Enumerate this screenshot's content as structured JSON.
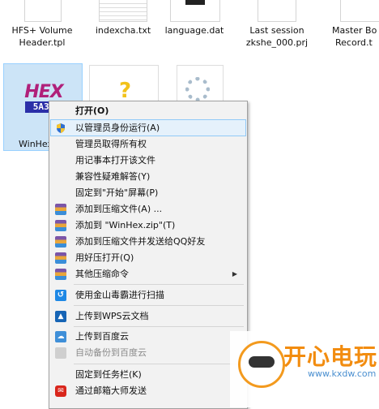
{
  "files": [
    {
      "label_line1": "HFS+ Volume",
      "label_line2": "Header.tpl"
    },
    {
      "label_line1": "indexcha.txt",
      "label_line2": ""
    },
    {
      "label_line1": "language.dat",
      "label_line2": ""
    },
    {
      "label_line1": "Last session",
      "label_line2": "zkshe_000.prj"
    },
    {
      "label_line1": "Master Bo",
      "label_line2": "Record.t"
    }
  ],
  "winhex": {
    "label": "WinHex",
    "icon_text": "HEX",
    "icon_sub": "5A3F"
  },
  "menu": {
    "items": [
      {
        "label": "打开(O)",
        "icon": "none"
      },
      {
        "label": "以管理员身份运行(A)",
        "icon": "uac-shield-icon"
      },
      {
        "label": "管理员取得所有权",
        "icon": "none"
      },
      {
        "label": "用记事本打开该文件",
        "icon": "none"
      },
      {
        "label": "兼容性疑难解答(Y)",
        "icon": "none"
      },
      {
        "label": "固定到\"开始\"屏幕(P)",
        "icon": "none"
      },
      {
        "label": "添加到压缩文件(A) ...",
        "icon": "archive-icon"
      },
      {
        "label": "添加到 \"WinHex.zip\"(T)",
        "icon": "archive-icon"
      },
      {
        "label": "添加到压缩文件并发送给QQ好友",
        "icon": "archive-icon"
      },
      {
        "label": "用好压打开(Q)",
        "icon": "archive-icon"
      },
      {
        "label": "其他压缩命令",
        "icon": "archive-icon"
      },
      {
        "label": "使用金山毒霸进行扫描",
        "icon": "kingsoft-icon"
      },
      {
        "label": "上传到WPS云文档",
        "icon": "wps-cloud-icon"
      },
      {
        "label": "上传到百度云",
        "icon": "baidu-cloud-icon"
      },
      {
        "label": "自动备份到百度云",
        "icon": "baidu-backup-icon"
      },
      {
        "label": "固定到任务栏(K)",
        "icon": "none"
      },
      {
        "label": "通过邮箱大师发送",
        "icon": "mail-master-icon"
      }
    ]
  },
  "watermark": {
    "title": "开心电玩",
    "url": "www.kxdw.com"
  },
  "colors": {
    "selection": "#cce4f7",
    "menu_bg": "#f2f2f2",
    "highlight": "#e5f1fb",
    "watermark_orange": "#f28c0f"
  }
}
